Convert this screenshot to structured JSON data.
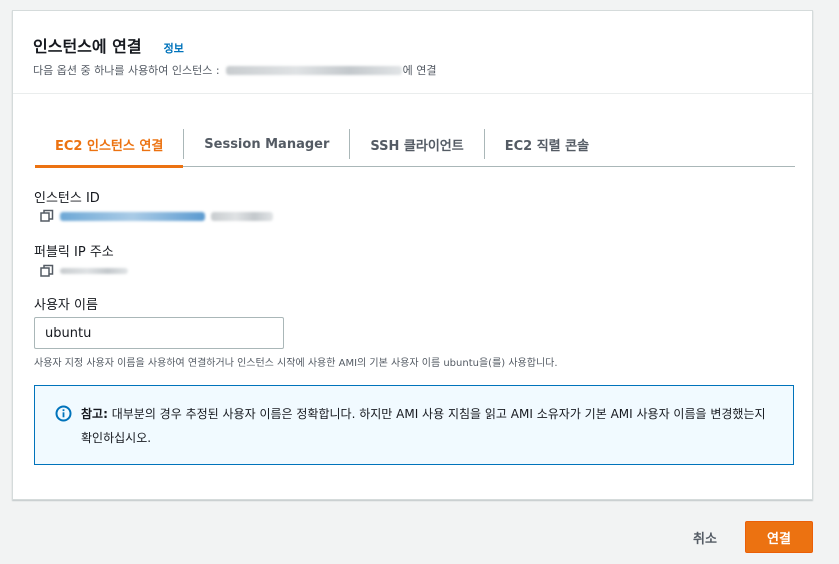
{
  "header": {
    "title": "인스턴스에 연결",
    "info_link": "정보",
    "subtitle_prefix": "다음 옵션 중 하나를 사용하여 인스턴스 :",
    "subtitle_suffix": "에 연결"
  },
  "tabs": [
    {
      "label": "EC2 인스턴스 연결",
      "active": true
    },
    {
      "label": "Session Manager",
      "active": false
    },
    {
      "label": "SSH 클라이언트",
      "active": false
    },
    {
      "label": "EC2 직렬 콘솔",
      "active": false
    }
  ],
  "instance_id": {
    "label": "인스턴스 ID"
  },
  "public_ip": {
    "label": "퍼블릭 IP 주소"
  },
  "username": {
    "label": "사용자 이름",
    "value": "ubuntu",
    "hint": "사용자 지정 사용자 이름을 사용하여 연결하거나 인스턴스 시작에 사용한 AMI의 기본 사용자 이름 ubuntu을(를) 사용합니다."
  },
  "alert": {
    "bold": "참고:",
    "text": " 대부분의 경우 추정된 사용자 이름은 정확합니다. 하지만 AMI 사용 지침을 읽고 AMI 소유자가 기본 AMI 사용자 이름을 변경했는지 확인하십시오."
  },
  "footer": {
    "cancel_label": "취소",
    "connect_label": "연결"
  },
  "colors": {
    "accent": "#ec7211",
    "link": "#0073bb",
    "info_bg": "#f1faff"
  }
}
